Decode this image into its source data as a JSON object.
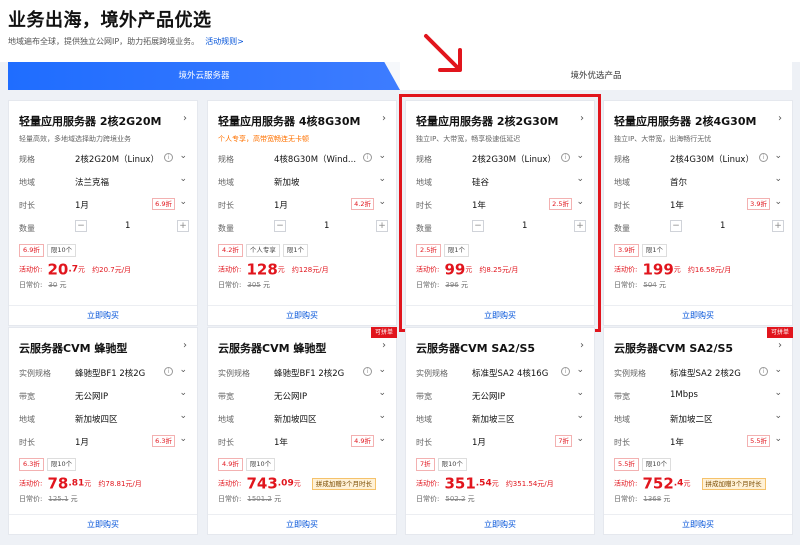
{
  "header": {
    "title": "业务出海，境外产品优选",
    "subtitle": "地域遍布全球，提供独立公网IP，助力拓展跨境业务。",
    "rule_link": "活动规则>"
  },
  "tabs": [
    "境外云服务器",
    "境外优选产品"
  ],
  "colors": {
    "accent": "#0052d9",
    "price_red": "#e1151d",
    "highlight": "#e1151d"
  },
  "cards": [
    {
      "title": "轻量应用服务器 2核2G20M",
      "desc": "轻量高效，多地域选择助力跨境业务",
      "desc_color": "gray",
      "rows": [
        {
          "label": "规格",
          "value": "2核2G20M（Linux）",
          "info": true
        },
        {
          "label": "地域",
          "value": "法兰克福"
        },
        {
          "label": "时长",
          "value": "1月",
          "discount": "6.9折"
        }
      ],
      "qty_label": "数量",
      "qty": "1",
      "tags": [
        {
          "text": "6.9折",
          "red": true
        },
        {
          "text": "限10个"
        }
      ],
      "price_label": "活动价:",
      "price_int": "20",
      "price_dec": ".7",
      "price_unit": "元",
      "price_monthly": "约20.7元/月",
      "promo": "",
      "orig_label": "日常价:",
      "orig_price": "30",
      "orig_unit": "元",
      "buy": "立即购买"
    },
    {
      "title": "轻量应用服务器 4核8G30M",
      "desc": "个人专享，高带宽畅连无卡顿",
      "desc_color": "orange",
      "rows": [
        {
          "label": "规格",
          "value": "4核8G30M（Wind...",
          "info": true
        },
        {
          "label": "地域",
          "value": "新加坡"
        },
        {
          "label": "时长",
          "value": "1月",
          "discount": "4.2折"
        }
      ],
      "qty_label": "数量",
      "qty": "1",
      "tags": [
        {
          "text": "4.2折",
          "red": true
        },
        {
          "text": "个人专享"
        },
        {
          "text": "限1个"
        }
      ],
      "price_label": "活动价:",
      "price_int": "128",
      "price_dec": "",
      "price_unit": "元",
      "price_monthly": "约128元/月",
      "promo": "",
      "orig_label": "日常价:",
      "orig_price": "305",
      "orig_unit": "元",
      "buy": "立即购买"
    },
    {
      "title": "轻量应用服务器 2核2G30M",
      "desc": "独立IP、大带宽，畅享极速低延迟",
      "desc_color": "gray",
      "rows": [
        {
          "label": "规格",
          "value": "2核2G30M（Linux）",
          "info": true
        },
        {
          "label": "地域",
          "value": "硅谷"
        },
        {
          "label": "时长",
          "value": "1年",
          "discount": "2.5折"
        }
      ],
      "qty_label": "数量",
      "qty": "1",
      "tags": [
        {
          "text": "2.5折",
          "red": true
        },
        {
          "text": "限1个"
        }
      ],
      "price_label": "活动价:",
      "price_int": "99",
      "price_dec": "",
      "price_unit": "元",
      "price_monthly": "约8.25元/月",
      "promo": "",
      "orig_label": "日常价:",
      "orig_price": "396",
      "orig_unit": "元",
      "buy": "立即购买"
    },
    {
      "title": "轻量应用服务器 2核4G30M",
      "desc": "独立IP、大带宽，出海畅行无忧",
      "desc_color": "gray",
      "rows": [
        {
          "label": "规格",
          "value": "2核4G30M（Linux）",
          "info": true
        },
        {
          "label": "地域",
          "value": "首尔"
        },
        {
          "label": "时长",
          "value": "1年",
          "discount": "3.9折"
        }
      ],
      "qty_label": "数量",
      "qty": "1",
      "tags": [
        {
          "text": "3.9折",
          "red": true
        },
        {
          "text": "限1个"
        }
      ],
      "price_label": "活动价:",
      "price_int": "199",
      "price_dec": "",
      "price_unit": "元",
      "price_monthly": "约16.58元/月",
      "promo": "",
      "orig_label": "日常价:",
      "orig_price": "504",
      "orig_unit": "元",
      "buy": "立即购买"
    },
    {
      "title": "云服务器CVM 蜂驰型",
      "desc": "",
      "desc_color": "gray",
      "rows": [
        {
          "label": "实例规格",
          "value": "蜂驰型BF1 2核2G",
          "info": true
        },
        {
          "label": "带宽",
          "value": "无公网IP"
        },
        {
          "label": "地域",
          "value": "新加坡四区"
        },
        {
          "label": "时长",
          "value": "1月",
          "discount": "6.3折"
        }
      ],
      "tags": [
        {
          "text": "6.3折",
          "red": true
        },
        {
          "text": "限10个"
        }
      ],
      "price_label": "活动价:",
      "price_int": "78",
      "price_dec": ".81",
      "price_unit": "元",
      "price_monthly": "约78.81元/月",
      "promo": "",
      "orig_label": "日常价:",
      "orig_price": "125.1",
      "orig_unit": "元",
      "buy": "立即购买"
    },
    {
      "title": "云服务器CVM 蜂驰型",
      "desc": "",
      "desc_color": "gray",
      "ribbon": "可拼单",
      "rows": [
        {
          "label": "实例规格",
          "value": "蜂驰型BF1 2核2G",
          "info": true
        },
        {
          "label": "带宽",
          "value": "无公网IP"
        },
        {
          "label": "地域",
          "value": "新加坡四区"
        },
        {
          "label": "时长",
          "value": "1年",
          "discount": "4.9折"
        }
      ],
      "tags": [
        {
          "text": "4.9折",
          "red": true
        },
        {
          "text": "限10个"
        }
      ],
      "price_label": "活动价:",
      "price_int": "743",
      "price_dec": ".09",
      "price_unit": "元",
      "price_monthly": "",
      "promo": "拼成加赠3个月时长",
      "orig_label": "日常价:",
      "orig_price": "1501.2",
      "orig_unit": "元",
      "buy": "立即购买"
    },
    {
      "title": "云服务器CVM SA2/S5",
      "desc": "",
      "desc_color": "gray",
      "rows": [
        {
          "label": "实例规格",
          "value": "标准型SA2 4核16G",
          "info": true
        },
        {
          "label": "带宽",
          "value": "无公网IP"
        },
        {
          "label": "地域",
          "value": "新加坡三区"
        },
        {
          "label": "时长",
          "value": "1月",
          "discount": "7折"
        }
      ],
      "tags": [
        {
          "text": "7折",
          "red": true
        },
        {
          "text": "限10个"
        }
      ],
      "price_label": "活动价:",
      "price_int": "351",
      "price_dec": ".54",
      "price_unit": "元",
      "price_monthly": "约351.54元/月",
      "promo": "",
      "orig_label": "日常价:",
      "orig_price": "502.2",
      "orig_unit": "元",
      "buy": "立即购买"
    },
    {
      "title": "云服务器CVM SA2/S5",
      "desc": "",
      "desc_color": "gray",
      "ribbon": "可拼单",
      "rows": [
        {
          "label": "实例规格",
          "value": "标准型SA2 2核2G",
          "info": true
        },
        {
          "label": "带宽",
          "value": "1Mbps"
        },
        {
          "label": "地域",
          "value": "新加坡二区"
        },
        {
          "label": "时长",
          "value": "1年",
          "discount": "5.5折"
        }
      ],
      "tags": [
        {
          "text": "5.5折",
          "red": true
        },
        {
          "text": "限10个"
        }
      ],
      "price_label": "活动价:",
      "price_int": "752",
      "price_dec": ".4",
      "price_unit": "元",
      "price_monthly": "",
      "promo": "拼成加赠3个月时长",
      "orig_label": "日常价:",
      "orig_price": "1368",
      "orig_unit": "元",
      "buy": "立即购买"
    }
  ]
}
